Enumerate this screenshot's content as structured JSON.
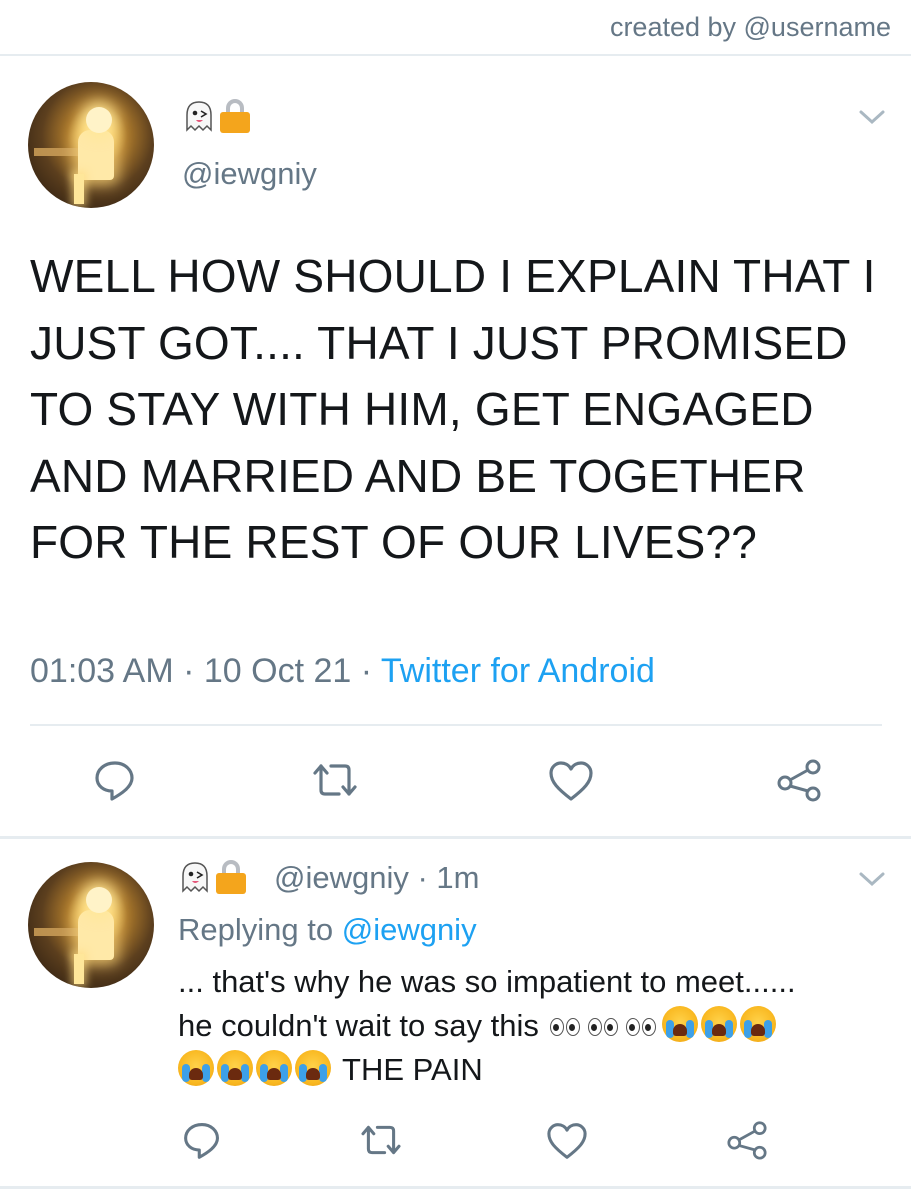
{
  "header": {
    "credit": "created by @username"
  },
  "main_tweet": {
    "handle": "@iewgniy",
    "badges": [
      "ghost-emoji",
      "lock-emoji"
    ],
    "text": "WELL HOW SHOULD I EXPLAIN THAT I JUST GOT.... THAT I JUST PROMISED TO STAY WITH HIM, GET ENGAGED AND MARRIED AND BE TOGETHER FOR THE REST OF OUR LIVES??",
    "time": "01:03 AM",
    "sep1": " · ",
    "date": "10 Oct 21",
    "sep2": " · ",
    "source": "Twitter for Android",
    "actions": [
      "reply-icon",
      "retweet-icon",
      "like-icon",
      "share-icon"
    ]
  },
  "reply_tweet": {
    "handle": "@iewgniy",
    "dot": " · ",
    "age": "1m",
    "replying_prefix": "Replying to ",
    "replying_handle": "@iewgniy",
    "text_line1": "... that's why he was so impatient to meet......",
    "text_line2": "he couldn't wait to say this ",
    "text_end": " THE PAIN",
    "emoji_eyes_count": 3,
    "emoji_crying_count": 7,
    "actions": [
      "reply-icon",
      "retweet-icon",
      "like-icon",
      "share-icon"
    ]
  },
  "colors": {
    "text": "#14171a",
    "muted": "#657786",
    "link": "#1da1f2",
    "divider": "#e6ecf0",
    "lock": "#f4a51c"
  }
}
